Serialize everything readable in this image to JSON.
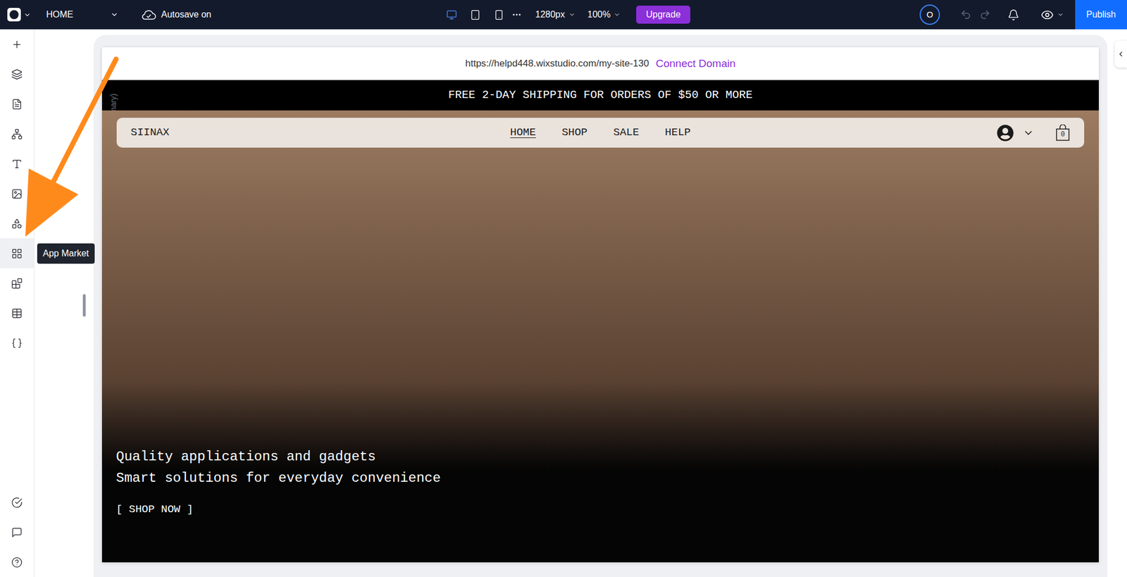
{
  "topbar": {
    "page": "HOME",
    "autosave": "Autosave on",
    "devices": [
      {
        "kind": "desktop",
        "selected": true
      },
      {
        "kind": "tablet",
        "selected": false
      },
      {
        "kind": "mobile",
        "selected": false
      }
    ],
    "width": "1280px",
    "zoom": "100%",
    "upgrade": "Upgrade",
    "avatar": "O",
    "undo_enabled": false,
    "redo_enabled": false,
    "publish": "Publish"
  },
  "sidebar": {
    "items": [
      {
        "kind": "add",
        "selected": false
      },
      {
        "kind": "layers",
        "selected": false
      },
      {
        "kind": "pages",
        "selected": false
      },
      {
        "kind": "sitemap",
        "selected": false
      },
      {
        "kind": "design",
        "selected": false
      },
      {
        "kind": "media",
        "selected": false
      },
      {
        "kind": "components",
        "selected": false
      },
      {
        "kind": "apps",
        "selected": true
      },
      {
        "kind": "blocks",
        "selected": false
      },
      {
        "kind": "cms",
        "selected": false
      },
      {
        "kind": "code",
        "selected": false
      }
    ],
    "bottom_items": [
      {
        "kind": "checklist",
        "selected": false
      },
      {
        "kind": "chat",
        "selected": false
      },
      {
        "kind": "help",
        "selected": false
      }
    ]
  },
  "tooltip": {
    "text": "App Market"
  },
  "canvas": {
    "label": "Desktop (Primary)"
  },
  "site": {
    "url": "https://helpd448.wixstudio.com/my-site-130",
    "connect": "Connect Domain",
    "banner": "FREE 2-DAY SHIPPING FOR ORDERS OF $50 OR MORE",
    "brand": "SIINAX",
    "nav": [
      {
        "label": "HOME",
        "selected": true
      },
      {
        "label": "SHOP",
        "selected": false
      },
      {
        "label": "SALE",
        "selected": false
      },
      {
        "label": "HELP",
        "selected": false
      }
    ],
    "cart_count": "0",
    "hero_lines": [
      "Quality applications and gadgets",
      "Smart solutions for everyday convenience"
    ],
    "cta": "[ SHOP NOW ]"
  }
}
